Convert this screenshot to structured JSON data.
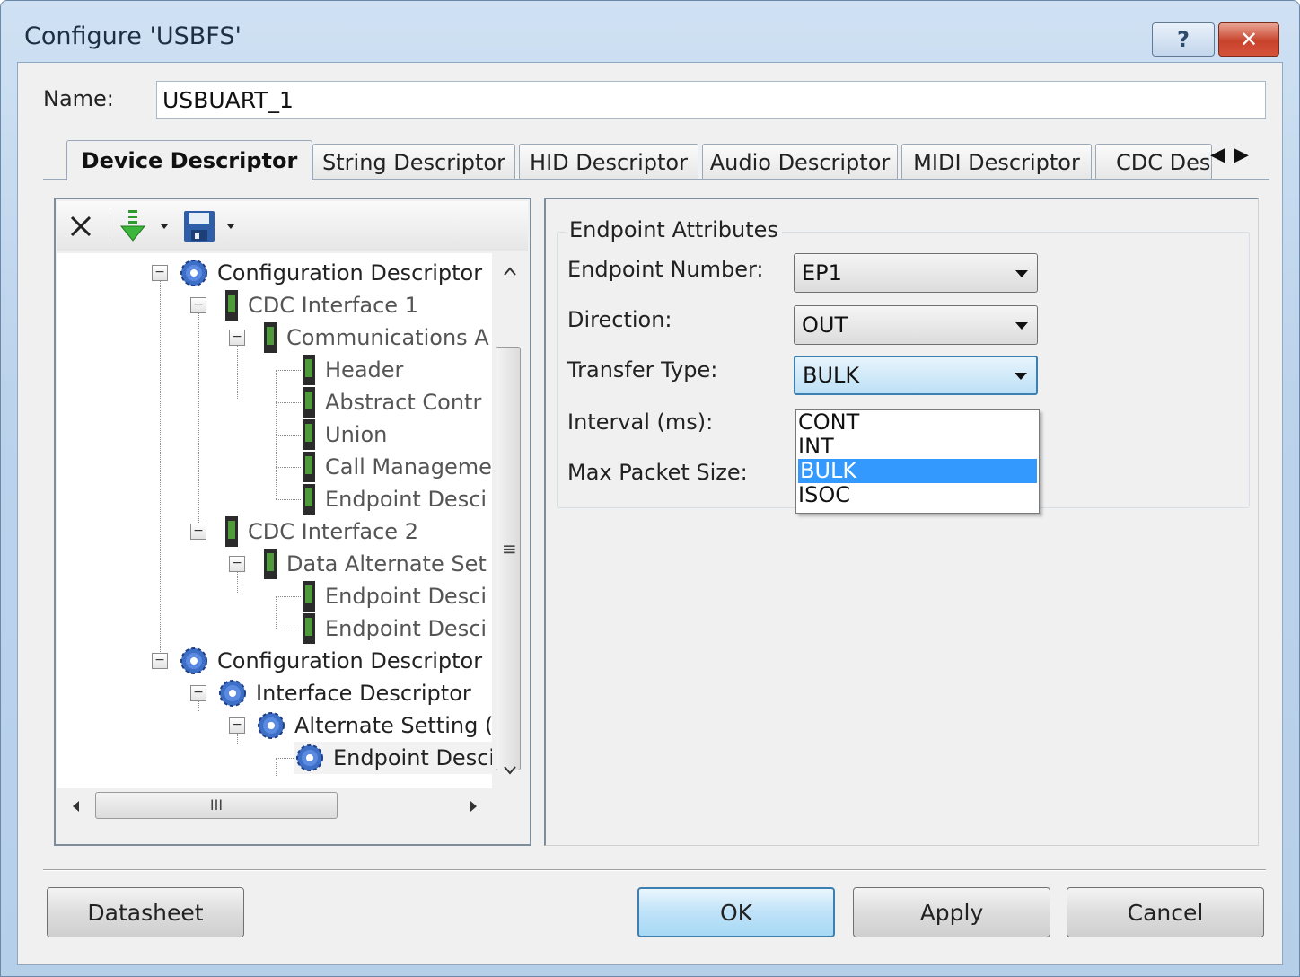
{
  "window": {
    "title": "Configure 'USBFS'",
    "help_glyph": "?",
    "close_glyph": "✕"
  },
  "name_field": {
    "label": "Name:",
    "value": "USBUART_1"
  },
  "tabs": [
    {
      "label": "Device Descriptor",
      "active": true
    },
    {
      "label": "String Descriptor",
      "active": false
    },
    {
      "label": "HID Descriptor",
      "active": false
    },
    {
      "label": "Audio Descriptor",
      "active": false
    },
    {
      "label": "MIDI Descriptor",
      "active": false
    },
    {
      "label": "CDC Des",
      "active": false
    }
  ],
  "tab_scroll": {
    "left": "◀",
    "right": "▶"
  },
  "tree": {
    "items": [
      {
        "label": "Configuration Descriptor",
        "icon": "gear-icon"
      },
      {
        "label": "CDC Interface 1",
        "icon": "device-icon"
      },
      {
        "label": "Communications A",
        "icon": "device-icon"
      },
      {
        "label": "Header",
        "icon": "device-icon"
      },
      {
        "label": "Abstract Contr",
        "icon": "device-icon"
      },
      {
        "label": "Union",
        "icon": "device-icon"
      },
      {
        "label": "Call Manageme",
        "icon": "device-icon"
      },
      {
        "label": "Endpoint Desci",
        "icon": "device-icon"
      },
      {
        "label": "CDC Interface 2",
        "icon": "device-icon"
      },
      {
        "label": "Data Alternate Set",
        "icon": "device-icon"
      },
      {
        "label": "Endpoint Desci",
        "icon": "device-icon"
      },
      {
        "label": "Endpoint Desci",
        "icon": "device-icon"
      },
      {
        "label": "Configuration Descriptor",
        "icon": "gear-icon"
      },
      {
        "label": "Interface Descriptor",
        "icon": "gear-icon"
      },
      {
        "label": "Alternate Setting (",
        "icon": "gear-icon"
      },
      {
        "label": "Endpoint Desci",
        "icon": "gear-icon"
      }
    ],
    "hscroll_grip": "III",
    "vscroll_grip": "≡"
  },
  "endpoint": {
    "group_title": "Endpoint Attributes",
    "number_label": "Endpoint Number:",
    "number_value": "EP1",
    "direction_label": "Direction:",
    "direction_value": "OUT",
    "transfer_label": "Transfer Type:",
    "transfer_value": "BULK",
    "interval_label": "Interval (ms):",
    "max_packet_label": "Max Packet Size:",
    "transfer_options": [
      "CONT",
      "INT",
      "BULK",
      "ISOC"
    ],
    "transfer_selected_index": 2
  },
  "buttons": {
    "datasheet": "Datasheet",
    "ok": "OK",
    "apply": "Apply",
    "cancel": "Cancel"
  },
  "colors": {
    "selection": "#3399ff",
    "default_button_border": "#3c7fb1",
    "close_button": "#c8432c"
  }
}
